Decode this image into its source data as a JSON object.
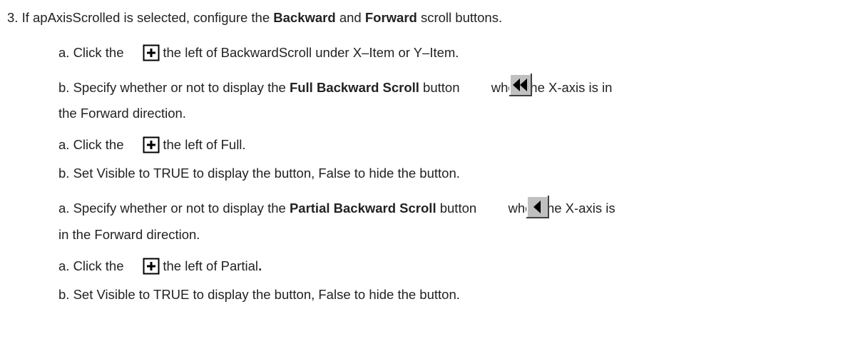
{
  "step3": {
    "prefix": "3. If apAxisScrolled is selected, configure the ",
    "b1": "Backward",
    "mid": " and ",
    "b2": "Forward",
    "suffix": " scroll buttons."
  },
  "items": [
    {
      "pre": "a. Click the ",
      "post": " to the left of BackwardScroll under X–Item or Y–Item."
    },
    {
      "pre": "b. Specify whether or not to display the ",
      "bold": "Full Backward Scroll",
      "mid": " button ",
      "post": " when the X-axis is in",
      "cont": "the Forward direction."
    },
    {
      "pre": "a. Click the ",
      "post": " to the left of Full."
    },
    {
      "text": "b. Set Visible to TRUE to display the button, False to hide the button."
    },
    {
      "pre": "a. Specify whether or not to display the ",
      "bold": "Partial Backward Scroll",
      "mid": " button ",
      "post": " when the X-axis is",
      "cont": "in the Forward direction."
    },
    {
      "pre": "a. Click the ",
      "post": " to the left of Partial",
      "post_bold": "."
    },
    {
      "text": "b. Set Visible to TRUE to display the button, False to hide the button."
    }
  ],
  "icons": {
    "expand": "plus-box-icon",
    "full_backward": "double-left-arrow-icon",
    "partial_backward": "left-arrow-icon"
  }
}
